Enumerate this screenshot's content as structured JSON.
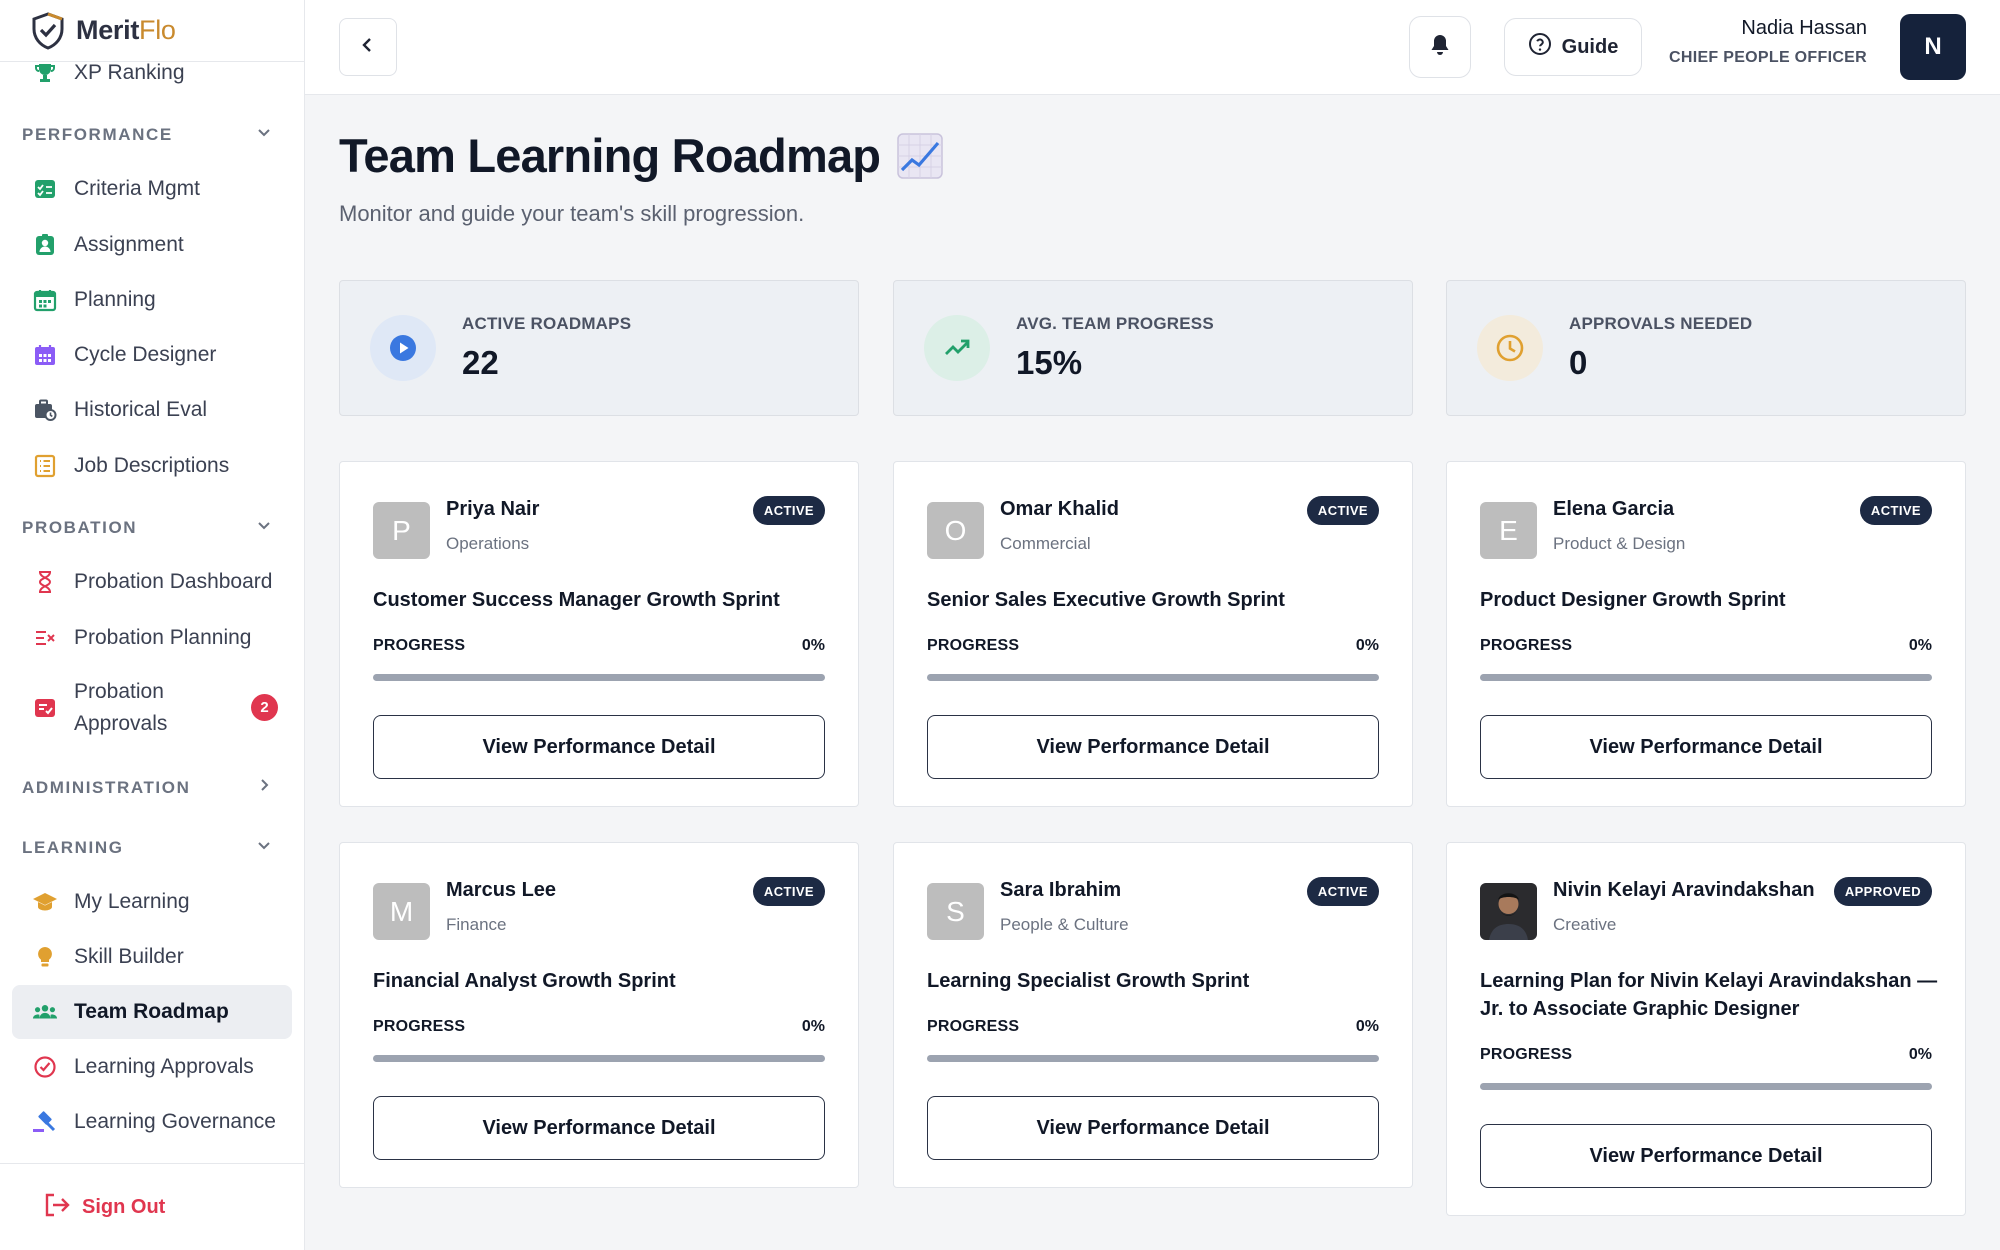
{
  "app": {
    "logo_main": "Merit",
    "logo_accent": "Flo",
    "colors": {
      "primary": "#1d2a44",
      "danger": "#e0364f",
      "accent": "#c98a2e"
    }
  },
  "sidebar": {
    "top_item": {
      "label": "XP Ranking",
      "icon": "trophy-icon"
    },
    "sections": [
      {
        "title": "PERFORMANCE",
        "chevron": "chevron-down-icon",
        "items": [
          {
            "label": "Criteria Mgmt",
            "icon": "checklist-icon"
          },
          {
            "label": "Assignment",
            "icon": "user-badge-icon"
          },
          {
            "label": "Planning",
            "icon": "calendar-icon"
          },
          {
            "label": "Cycle Designer",
            "icon": "calendar-grid-icon"
          },
          {
            "label": "Historical Eval",
            "icon": "briefcase-clock-icon"
          },
          {
            "label": "Job Descriptions",
            "icon": "list-doc-icon"
          }
        ]
      },
      {
        "title": "PROBATION",
        "chevron": "chevron-down-icon",
        "items": [
          {
            "label": "Probation Dashboard",
            "icon": "hourglass-icon"
          },
          {
            "label": "Probation Planning",
            "icon": "list-x-icon"
          },
          {
            "label": "Probation Approvals",
            "icon": "check-doc-icon",
            "badge": "2"
          }
        ]
      },
      {
        "title": "ADMINISTRATION",
        "chevron": "chevron-right-icon",
        "items": []
      },
      {
        "title": "LEARNING",
        "chevron": "chevron-down-icon",
        "items": [
          {
            "label": "My Learning",
            "icon": "graduation-cap-icon"
          },
          {
            "label": "Skill Builder",
            "icon": "lightbulb-icon"
          },
          {
            "label": "Team Roadmap",
            "icon": "team-icon",
            "active": true
          },
          {
            "label": "Learning Approvals",
            "icon": "check-circle-icon"
          },
          {
            "label": "Learning Governance",
            "icon": "gavel-icon"
          }
        ]
      }
    ],
    "sign_out": "Sign Out"
  },
  "topbar": {
    "guide_label": "Guide",
    "user": {
      "name": "Nadia Hassan",
      "role": "CHIEF PEOPLE OFFICER",
      "initial": "N"
    }
  },
  "page": {
    "title": "Team Learning Roadmap",
    "subtitle": "Monitor and guide your team's skill progression."
  },
  "stats": [
    {
      "label": "ACTIVE ROADMAPS",
      "value": "22",
      "icon": "play-circle-icon",
      "color": "#3a78e0"
    },
    {
      "label": "AVG. TEAM PROGRESS",
      "value": "15%",
      "icon": "trend-up-icon",
      "color": "#22a06b"
    },
    {
      "label": "APPROVALS NEEDED",
      "value": "0",
      "icon": "clock-icon",
      "color": "#e0a030"
    }
  ],
  "roadmaps": [
    {
      "initial": "P",
      "name": "Priya Nair",
      "department": "Operations",
      "status": "ACTIVE",
      "title": "Customer Success Manager Growth Sprint",
      "progress_label": "PROGRESS",
      "progress_text": "0%",
      "progress": 0,
      "button": "View Performance Detail"
    },
    {
      "initial": "O",
      "name": "Omar Khalid",
      "department": "Commercial",
      "status": "ACTIVE",
      "title": "Senior Sales Executive Growth Sprint",
      "progress_label": "PROGRESS",
      "progress_text": "0%",
      "progress": 0,
      "button": "View Performance Detail"
    },
    {
      "initial": "E",
      "name": "Elena Garcia",
      "department": "Product & Design",
      "status": "ACTIVE",
      "title": "Product Designer Growth Sprint",
      "progress_label": "PROGRESS",
      "progress_text": "0%",
      "progress": 0,
      "button": "View Performance Detail"
    },
    {
      "initial": "M",
      "name": "Marcus Lee",
      "department": "Finance",
      "status": "ACTIVE",
      "title": "Financial Analyst Growth Sprint",
      "progress_label": "PROGRESS",
      "progress_text": "0%",
      "progress": 0,
      "button": "View Performance Detail"
    },
    {
      "initial": "S",
      "name": "Sara Ibrahim",
      "department": "People & Culture",
      "status": "ACTIVE",
      "title": "Learning Specialist Growth Sprint",
      "progress_label": "PROGRESS",
      "progress_text": "0%",
      "progress": 0,
      "button": "View Performance Detail"
    },
    {
      "initial": "",
      "photo": true,
      "name": "Nivin Kelayi Aravindakshan",
      "department": "Creative",
      "status": "APPROVED",
      "title": "Learning Plan for Nivin Kelayi Aravindakshan — Jr. to Associate Graphic Designer",
      "progress_label": "PROGRESS",
      "progress_text": "0%",
      "progress": 0,
      "button": "View Performance Detail"
    }
  ]
}
